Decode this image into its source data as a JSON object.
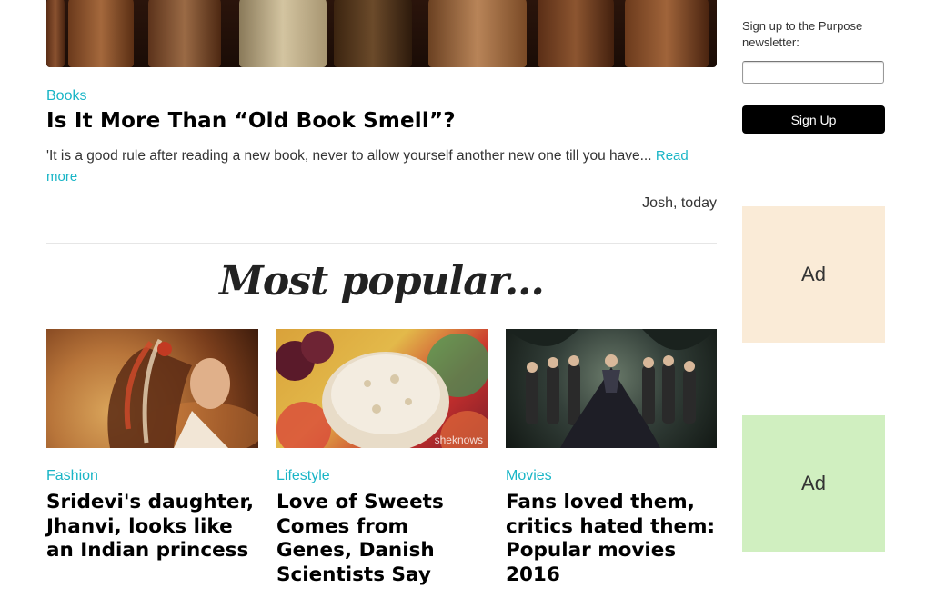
{
  "featured": {
    "category": "Books",
    "title": "Is It More Than “Old Book Smell”?",
    "excerpt": "'It is a good rule after reading a new book, never to allow yourself another new one till you have...",
    "read_more_label": "Read more",
    "byline": "Josh, today"
  },
  "section_title": "Most popular...",
  "cards": [
    {
      "category": "Fashion",
      "title": "Sridevi's daughter, Jhanvi, looks like an Indian princess"
    },
    {
      "category": "Lifestyle",
      "title": "Love of Sweets Comes from Genes, Danish Scientists Say",
      "watermark": "sheknows"
    },
    {
      "category": "Movies",
      "title": "Fans loved them, critics hated them: Popular movies 2016"
    }
  ],
  "sidebar": {
    "newsletter_label": "Sign up to the Purpose newsletter:",
    "email_value": "",
    "signup_label": "Sign Up",
    "ads": [
      {
        "label": "Ad",
        "color": "#faebd7"
      },
      {
        "label": "Ad",
        "color": "#d0efc0"
      }
    ]
  },
  "colors": {
    "accent": "#19b5c6",
    "button": "#000000"
  }
}
